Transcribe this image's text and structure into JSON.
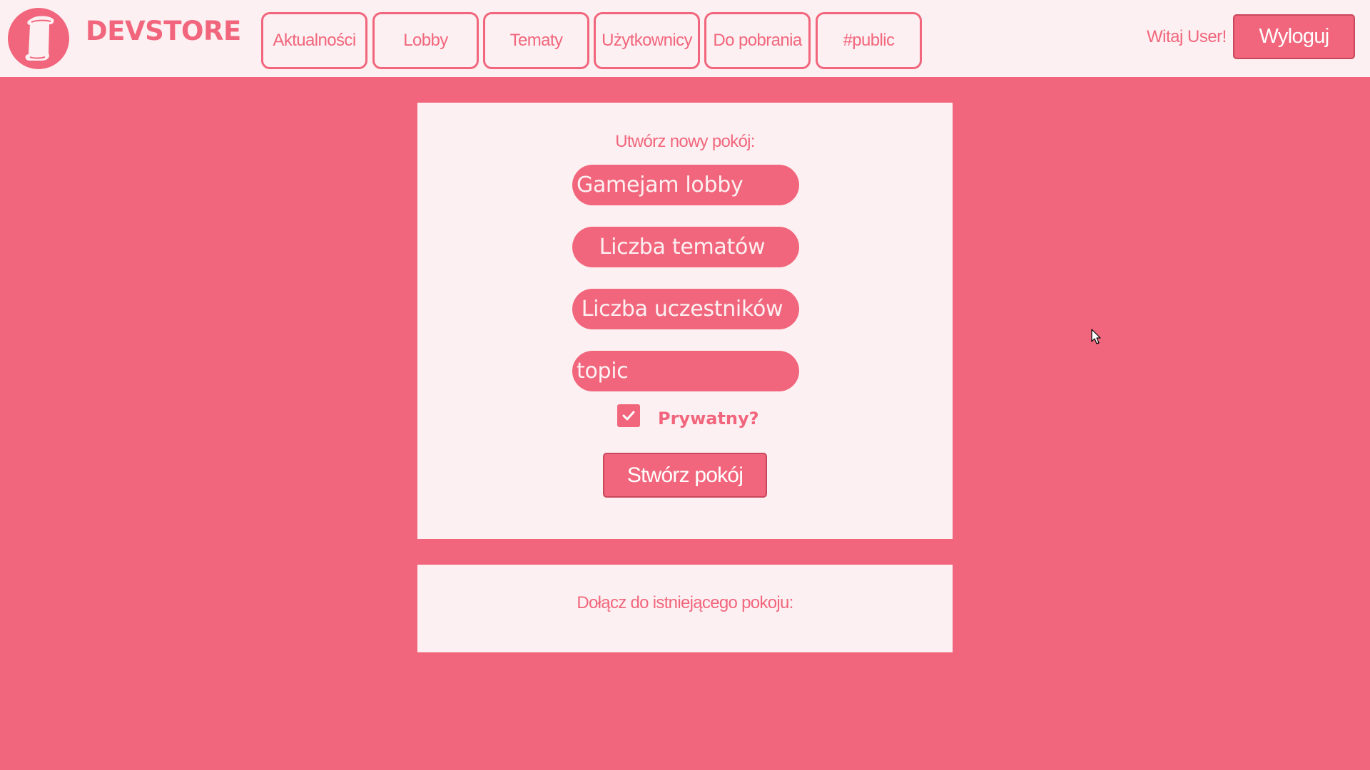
{
  "header": {
    "brand": "DEVSTORE",
    "logo_icon": "scroll-icon",
    "nav": [
      {
        "label": "Aktualności"
      },
      {
        "label": "Lobby"
      },
      {
        "label": "Tematy"
      },
      {
        "label": "Użytkownicy"
      },
      {
        "label": "Do pobrania"
      },
      {
        "label": "#public"
      }
    ],
    "greeting": "Witaj User!",
    "logout_label": "Wyloguj"
  },
  "create_room": {
    "title": "Utwórz nowy pokój:",
    "room_name_value": "Gamejam lobby",
    "topics_count_placeholder": "Liczba tematów",
    "participants_count_placeholder": "Liczba uczestników",
    "topic_value": "topic",
    "private_label": "Prywatny?",
    "private_checked": true,
    "submit_label": "Stwórz pokój"
  },
  "join_room": {
    "title": "Dołącz do istniejącego pokoju:"
  },
  "colors": {
    "accent": "#f1667c",
    "panel_bg": "#fdf0f2",
    "button_border": "#c9485c"
  }
}
